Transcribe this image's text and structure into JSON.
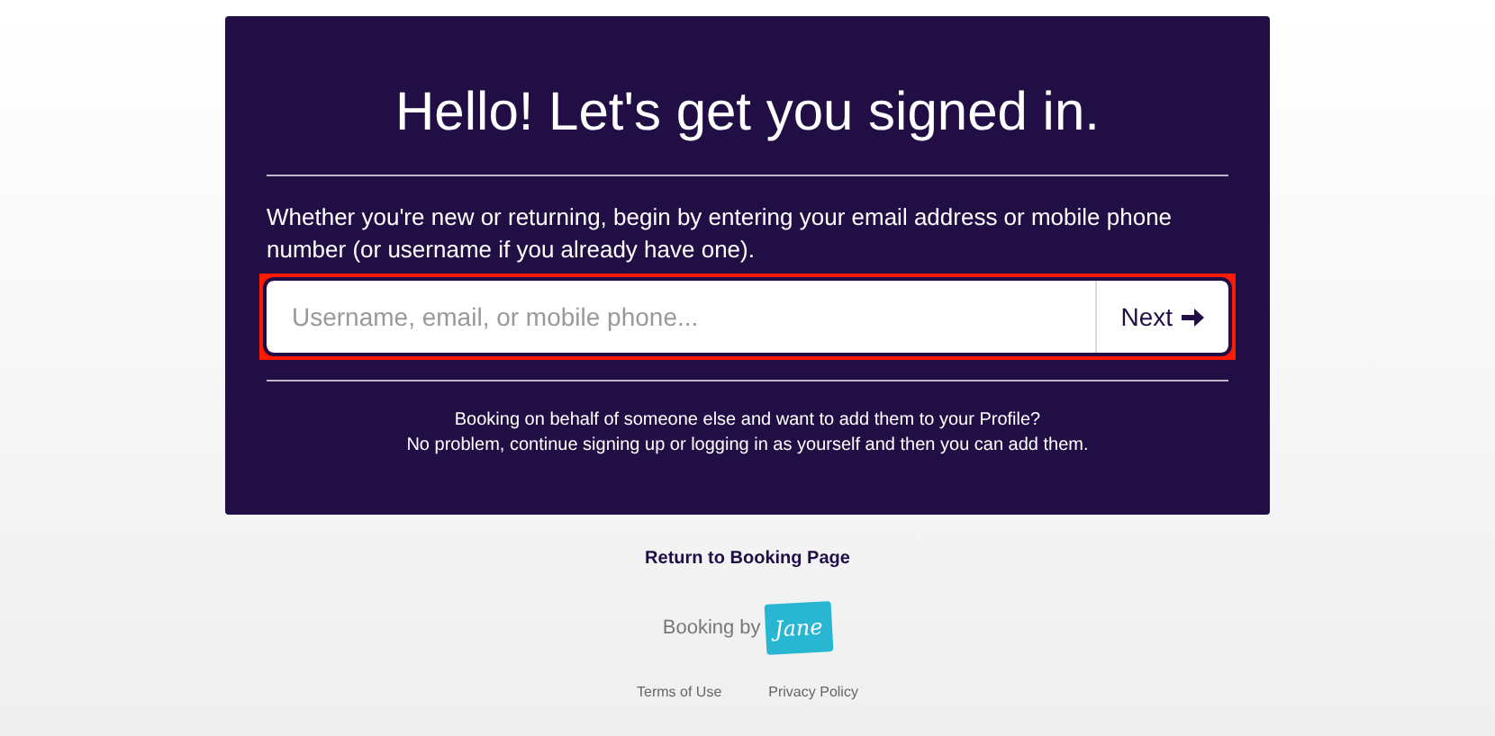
{
  "card": {
    "title": "Hello! Let's get you signed in.",
    "intro": "Whether you're new or returning, begin by entering your email address or mobile phone number (or username if you already have one).",
    "login_field": {
      "placeholder": "Username, email, or mobile phone...",
      "highlighted": true
    },
    "next_button": "Next",
    "info_lines": [
      "Booking on behalf of someone else and want to add them to your Profile?",
      "No problem, continue signing up or logging in as yourself and then you can add them."
    ]
  },
  "return_link": "Return to Booking Page",
  "powered_by": {
    "label": "Booking by",
    "logo_text": "Jane"
  },
  "footer_links": [
    "Terms of Use",
    "Privacy Policy"
  ]
}
